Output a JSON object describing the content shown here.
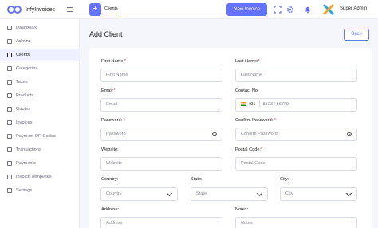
{
  "app": {
    "name": "InfyInvoices",
    "accent_color": "#6571ff"
  },
  "topbar": {
    "active_tab": "Clients",
    "new_invoice_label": "New Invoice",
    "user_name": "Super Admin",
    "icons": [
      "hamburger-icon",
      "plus-icon",
      "fullscreen-icon",
      "gear-icon",
      "bell-icon"
    ]
  },
  "sidebar": {
    "items": [
      {
        "label": "Dashboard",
        "icon": "dashboard-icon"
      },
      {
        "label": "Admins",
        "icon": "admin-icon"
      },
      {
        "label": "Clients",
        "icon": "users-icon",
        "active": true
      },
      {
        "label": "Categories",
        "icon": "categories-icon"
      },
      {
        "label": "Taxes",
        "icon": "taxes-icon"
      },
      {
        "label": "Products",
        "icon": "products-icon"
      },
      {
        "label": "Quotes",
        "icon": "quotes-icon"
      },
      {
        "label": "Invoices",
        "icon": "invoices-icon"
      },
      {
        "label": "Payment QR Codes",
        "icon": "qr-code-icon"
      },
      {
        "label": "Transactions",
        "icon": "transactions-icon"
      },
      {
        "label": "Payments",
        "icon": "payments-icon"
      },
      {
        "label": "Invoice Templates",
        "icon": "templates-icon"
      },
      {
        "label": "Settings",
        "icon": "settings-icon"
      }
    ]
  },
  "page": {
    "title": "Add Client",
    "back_label": "Back"
  },
  "form": {
    "first_name": {
      "label": "First Name:",
      "required": "*",
      "placeholder": "First Name"
    },
    "last_name": {
      "label": "Last Name:",
      "required": "*",
      "placeholder": "Last Name"
    },
    "email": {
      "label": "Email:",
      "required": "*",
      "placeholder": "Email"
    },
    "contact": {
      "label": "Contact No:",
      "country_code": "+91",
      "placeholder": "81234 56789"
    },
    "password": {
      "label": "Password:",
      "required": "*",
      "placeholder": "Password"
    },
    "confirm_password": {
      "label": "Confirm Password:",
      "required": "*",
      "placeholder": "Confirm Password"
    },
    "website": {
      "label": "Website:",
      "placeholder": "Website"
    },
    "postal_code": {
      "label": "Postal Code:",
      "required": "*",
      "placeholder": "Postal Code"
    },
    "country": {
      "label": "Country:",
      "value": "Country"
    },
    "state": {
      "label": "State:",
      "value": "State"
    },
    "city": {
      "label": "City:",
      "value": "City"
    },
    "address": {
      "label": "Address:",
      "placeholder": "Address"
    },
    "notes": {
      "label": "Notes:",
      "placeholder": "Notes"
    }
  }
}
